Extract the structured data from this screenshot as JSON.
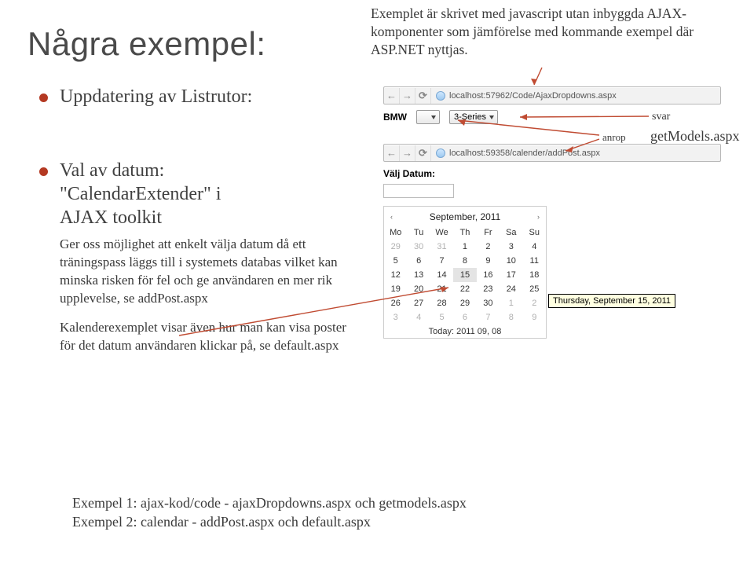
{
  "title": "Några exempel:",
  "intro": "Exemplet är skrivet med javascript utan inbyggda AJAX-komponenter som jämförelse med kommande exempel där ASP.NET nyttjas.",
  "bullets": {
    "b1": "Uppdatering av Listrutor:",
    "b2": "Val av datum: \"CalendarExtender\" i AJAX toolkit",
    "b2_line1": "Val av datum:",
    "b2_line2": "\"CalendarExtender\" i",
    "b2_line3": "AJAX toolkit"
  },
  "sub1": "Ger oss möjlighet att enkelt välja datum då ett träningspass läggs till i systemets databas vilket kan minska risken för fel och ge användaren en mer rik upplevelse, se addPost.aspx",
  "sub2": "Kalenderexemplet  visar även hur man kan visa poster för det datum användaren klickar på, se default.aspx",
  "footer": {
    "l1": "Exempel 1: ajax-kod/code - ajaxDropdowns.aspx och getmodels.aspx",
    "l2": "Exempel 2: calendar - addPost.aspx och default.aspx"
  },
  "browser1": {
    "url": "localhost:57962/Code/AjaxDropdowns.aspx"
  },
  "dropdowns": {
    "label": "BMW",
    "val1": "",
    "val2": "3-Series"
  },
  "browser2": {
    "url": "localhost:59358/calender/addPost.aspx"
  },
  "annot": {
    "svar": "svar",
    "anrop": "anrop",
    "gm": "getModels.aspx"
  },
  "calendar": {
    "label": "Välj Datum:",
    "month": "September, 2011",
    "days": [
      "Mo",
      "Tu",
      "We",
      "Th",
      "Fr",
      "Sa",
      "Su"
    ],
    "rows": [
      {
        "cells": [
          {
            "v": "29",
            "g": true
          },
          {
            "v": "30",
            "g": true
          },
          {
            "v": "31",
            "g": true
          },
          {
            "v": "1"
          },
          {
            "v": "2"
          },
          {
            "v": "3"
          },
          {
            "v": "4"
          }
        ]
      },
      {
        "cells": [
          {
            "v": "5"
          },
          {
            "v": "6"
          },
          {
            "v": "7"
          },
          {
            "v": "8"
          },
          {
            "v": "9"
          },
          {
            "v": "10"
          },
          {
            "v": "11"
          }
        ]
      },
      {
        "cells": [
          {
            "v": "12"
          },
          {
            "v": "13"
          },
          {
            "v": "14"
          },
          {
            "v": "15",
            "sel": true
          },
          {
            "v": "16"
          },
          {
            "v": "17"
          },
          {
            "v": "18"
          }
        ]
      },
      {
        "cells": [
          {
            "v": "19"
          },
          {
            "v": "20"
          },
          {
            "v": "21"
          },
          {
            "v": "22"
          },
          {
            "v": "23"
          },
          {
            "v": "24"
          },
          {
            "v": "25"
          }
        ]
      },
      {
        "cells": [
          {
            "v": "26"
          },
          {
            "v": "27"
          },
          {
            "v": "28"
          },
          {
            "v": "29"
          },
          {
            "v": "30"
          },
          {
            "v": "1",
            "g": true
          },
          {
            "v": "2",
            "g": true
          }
        ]
      },
      {
        "cells": [
          {
            "v": "3",
            "g": true
          },
          {
            "v": "4",
            "g": true
          },
          {
            "v": "5",
            "g": true
          },
          {
            "v": "6",
            "g": true
          },
          {
            "v": "7",
            "g": true
          },
          {
            "v": "8",
            "g": true
          },
          {
            "v": "9",
            "g": true
          }
        ]
      }
    ],
    "today": "Today: 2011 09, 08",
    "tooltip": "Thursday, September 15, 2011"
  },
  "nav": {
    "prev": "‹",
    "next": "›"
  }
}
